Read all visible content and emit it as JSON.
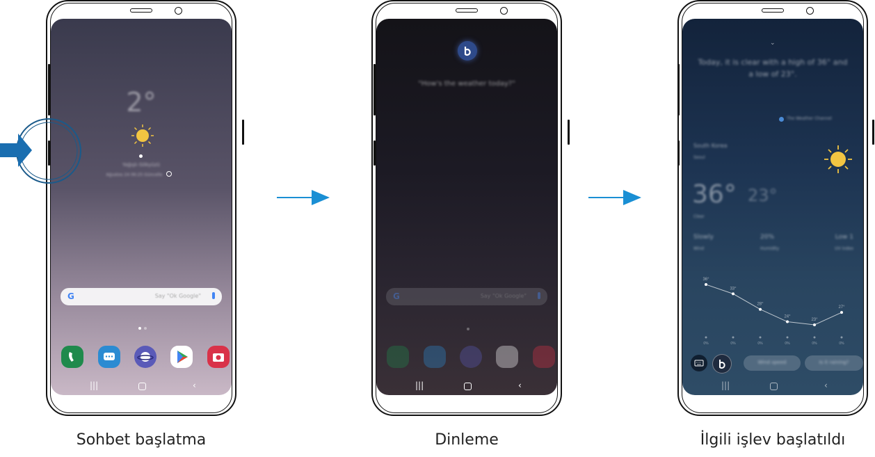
{
  "captions": [
    "Sohbet başlatma",
    "Dinleme",
    "İlgili işlev başlatıldı"
  ],
  "screen1": {
    "temperature": "2°",
    "location": "Yağışlı Gökyüzü",
    "updated": "Ağustos 24 06:25 Güncelle",
    "search_placeholder": "Say \"Ok Google\"",
    "google_letter": "G"
  },
  "screen2": {
    "query": "\"How's the weather today?\"",
    "google_letter": "G",
    "search_placeholder": "Say \"Ok Google\""
  },
  "screen3": {
    "response": "Today, it is clear with a high of 36° and a low of 23°.",
    "provider": "The Weather Channel",
    "region": "South Korea",
    "city": "Seoul",
    "temp_high": "36°",
    "temp_low": "23°",
    "condition": "Clear",
    "stats": [
      {
        "value": "Slowly",
        "label": "Wind"
      },
      {
        "value": "20%",
        "label": "Humidity"
      },
      {
        "value": "Low 1",
        "label": "UV index"
      }
    ],
    "hourly_temps": [
      "36°",
      "33°",
      "28°",
      "24°",
      "23°",
      "27°"
    ],
    "hourly_precip": [
      "0%",
      "0%",
      "0%",
      "0%",
      "0%",
      "0%"
    ],
    "chip_wind": "Wind speed",
    "chip_raining": "Is it raining?"
  },
  "icons": {
    "dock": [
      "phone-icon",
      "messages-icon",
      "internet-icon",
      "play-store-icon",
      "camera-icon"
    ]
  },
  "colors": {
    "arrow": "#1a8fd4",
    "sun": "#f2c542",
    "bixby": "#2e4a8a"
  }
}
